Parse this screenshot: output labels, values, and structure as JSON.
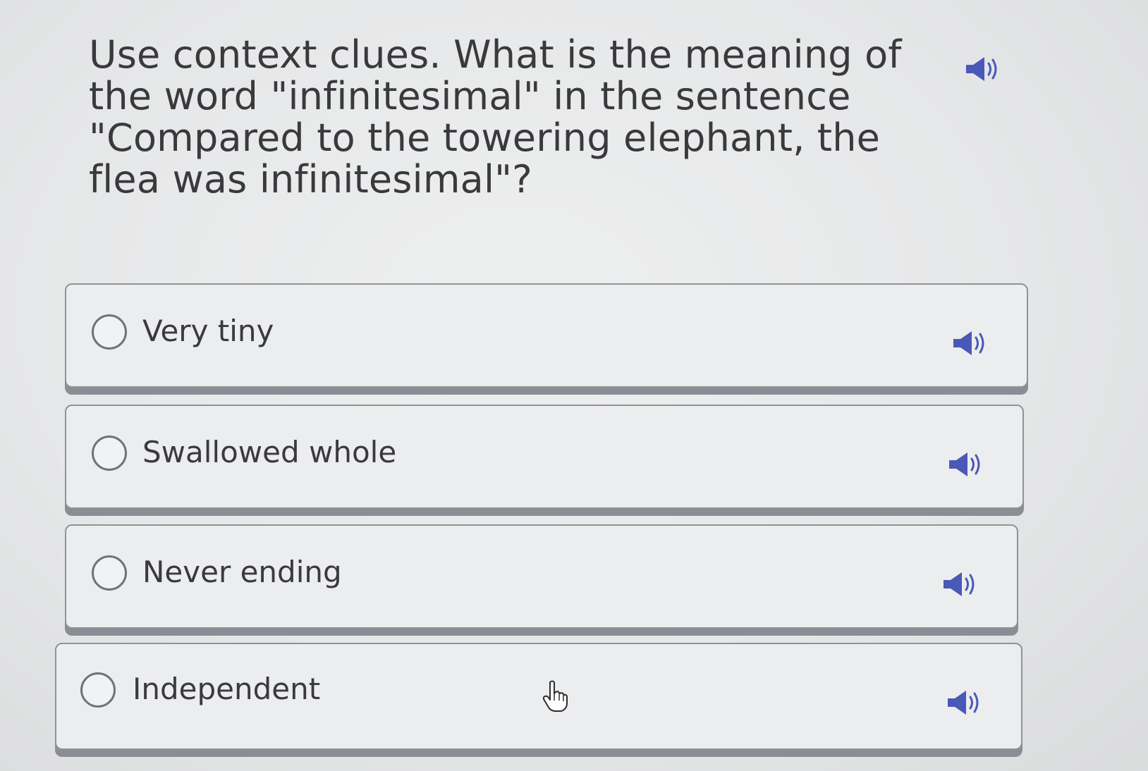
{
  "question": {
    "text": "Use context clues. What is the meaning of the word \"infinitesimal\" in the sentence \"Compared to the towering elephant, the flea was infinitesimal\"?",
    "audio_icon": "speaker-icon"
  },
  "options": [
    {
      "label": "Very tiny",
      "audio_icon": "speaker-icon"
    },
    {
      "label": "Swallowed whole",
      "audio_icon": "speaker-icon"
    },
    {
      "label": "Never ending",
      "audio_icon": "speaker-icon"
    },
    {
      "label": "Independent",
      "audio_icon": "speaker-icon"
    }
  ],
  "colors": {
    "speaker": "#4a58b8",
    "text": "#3a3a3c",
    "option_background": "#ecedee",
    "option_border": "#8f9398"
  },
  "cursor_icon": "hand-pointer-icon"
}
